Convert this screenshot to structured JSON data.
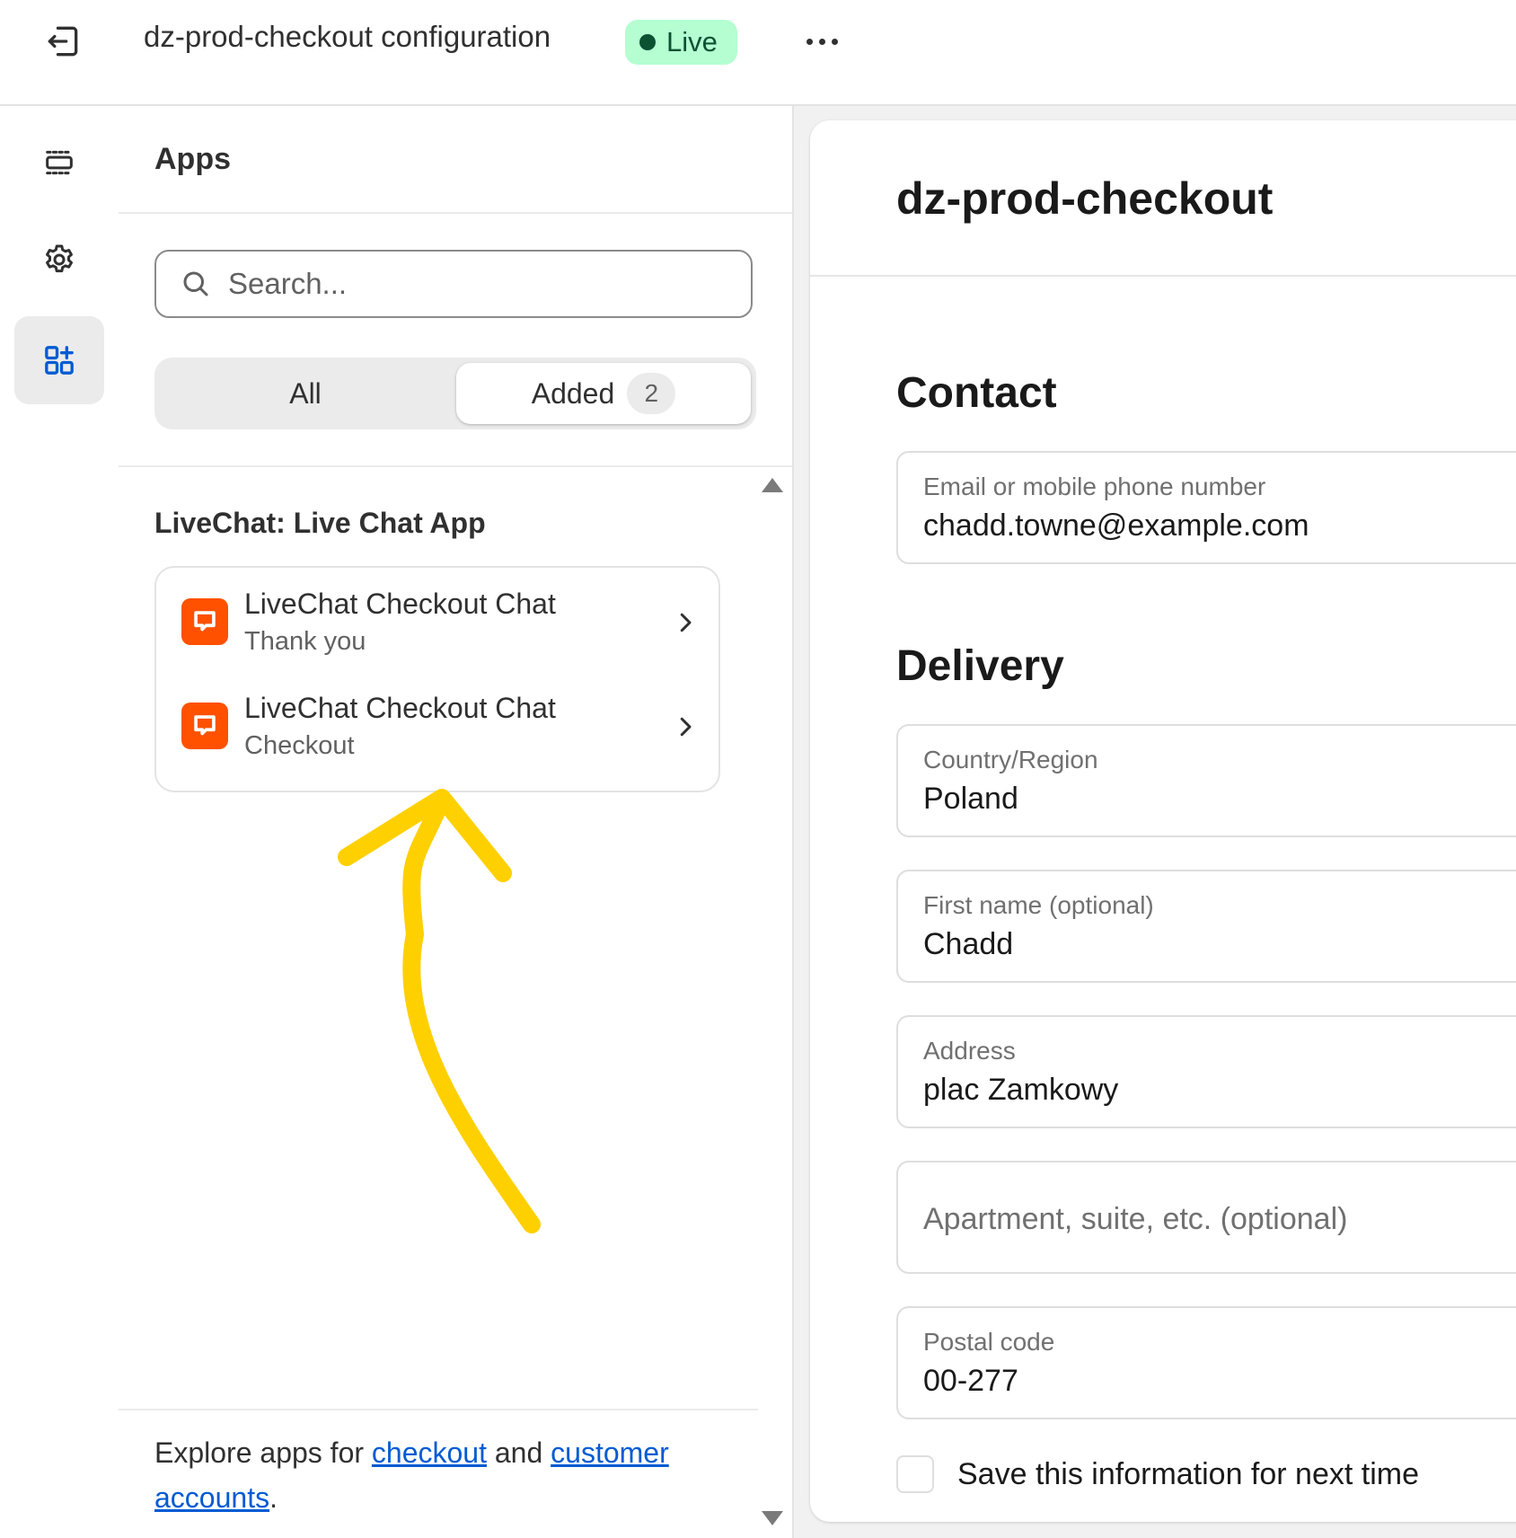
{
  "topbar": {
    "title": "dz-prod-checkout configuration",
    "status_badge": "Live",
    "icons": {
      "exit": "exit-icon",
      "more": "more-horizontal-icon"
    }
  },
  "rail": {
    "items": [
      {
        "icon": "layout-sections-icon",
        "active": false
      },
      {
        "icon": "gear-icon",
        "active": false
      },
      {
        "icon": "apps-add-icon",
        "active": true
      }
    ]
  },
  "apps_panel": {
    "title": "Apps",
    "search": {
      "placeholder": "Search...",
      "value": ""
    },
    "tabs": [
      {
        "label": "All",
        "selected": false
      },
      {
        "label": "Added",
        "selected": true,
        "count": "2"
      }
    ],
    "section_title": "LiveChat: Live Chat App",
    "apps": [
      {
        "name": "LiveChat Checkout Chat",
        "location": "Thank you",
        "icon": "livechat-icon"
      },
      {
        "name": "LiveChat Checkout Chat",
        "location": "Checkout",
        "icon": "livechat-icon"
      }
    ],
    "footer": {
      "prefix": "Explore apps for ",
      "link1": "checkout",
      "middle": " and ",
      "link2": "customer accounts",
      "suffix": "."
    }
  },
  "preview": {
    "shop_name": "dz-prod-checkout",
    "contact": {
      "heading": "Contact",
      "email_label": "Email or mobile phone number",
      "email_value": "chadd.towne@example.com"
    },
    "delivery": {
      "heading": "Delivery",
      "fields": [
        {
          "label": "Country/Region",
          "value": "Poland"
        },
        {
          "label": "First name (optional)",
          "value": "Chadd"
        },
        {
          "label": "Address",
          "value": "plac Zamkowy"
        },
        {
          "label": "",
          "placeholder": "Apartment, suite, etc. (optional)",
          "value": ""
        },
        {
          "label": "Postal code",
          "value": "00-277"
        }
      ],
      "save_info_label": "Save this information for next time",
      "save_info_checked": false
    }
  },
  "colors": {
    "accent_link": "#005bd3",
    "live_badge_bg": "#b4fed2",
    "live_badge_text": "#0c5132",
    "app_icon": "#ff5100",
    "annotation_arrow": "#ffd000"
  }
}
